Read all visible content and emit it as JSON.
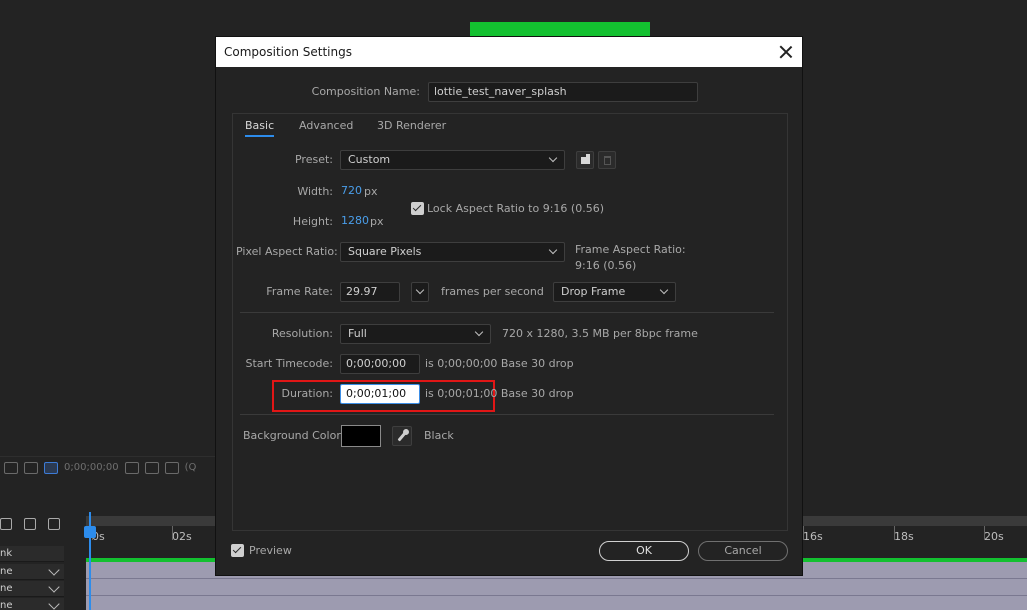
{
  "background": {
    "toolbar_timecode": "0;00;00;00",
    "toolbar_trail": "(Q",
    "ruler_ticks": [
      "0s",
      "02s",
      "16s",
      "18s",
      "20s"
    ],
    "layer_labels": [
      "nk",
      "ne",
      "ne",
      "ne"
    ]
  },
  "dialog": {
    "title": "Composition Settings",
    "comp_name_label": "Composition Name:",
    "comp_name_value": "lottie_test_naver_splash",
    "tabs": [
      {
        "label": "Basic",
        "active": true
      },
      {
        "label": "Advanced",
        "active": false
      },
      {
        "label": "3D Renderer",
        "active": false
      }
    ],
    "preset": {
      "label": "Preset:",
      "value": "Custom"
    },
    "width": {
      "label": "Width:",
      "value": "720",
      "unit": "px"
    },
    "height": {
      "label": "Height:",
      "value": "1280",
      "unit": "px"
    },
    "lock_aspect": {
      "label": "Lock Aspect Ratio to 9:16 (0.56)",
      "checked": true
    },
    "pixel_aspect": {
      "label": "Pixel Aspect Ratio:",
      "value": "Square Pixels"
    },
    "frame_aspect": {
      "label": "Frame Aspect Ratio:",
      "value": "9:16 (0.56)"
    },
    "frame_rate": {
      "label": "Frame Rate:",
      "value": "29.97",
      "unit": "frames per second",
      "drop": "Drop Frame"
    },
    "resolution": {
      "label": "Resolution:",
      "value": "Full",
      "info": "720 x 1280, 3.5 MB per 8bpc frame"
    },
    "start_timecode": {
      "label": "Start Timecode:",
      "value": "0;00;00;00",
      "info": "is 0;00;00;00  Base 30  drop"
    },
    "duration": {
      "label": "Duration:",
      "value": "0;00;01;00",
      "info": "is 0;00;01;00  Base 30  drop"
    },
    "background_color": {
      "label": "Background Color:",
      "name": "Black",
      "hex": "#000000"
    },
    "preview": {
      "label": "Preview",
      "checked": true
    },
    "ok_label": "OK",
    "cancel_label": "Cancel"
  },
  "colors": {
    "accent": "#2d8ceb",
    "link_value": "#4a9eea",
    "highlight_box": "#e11616",
    "timeline_green": "#13c030"
  }
}
